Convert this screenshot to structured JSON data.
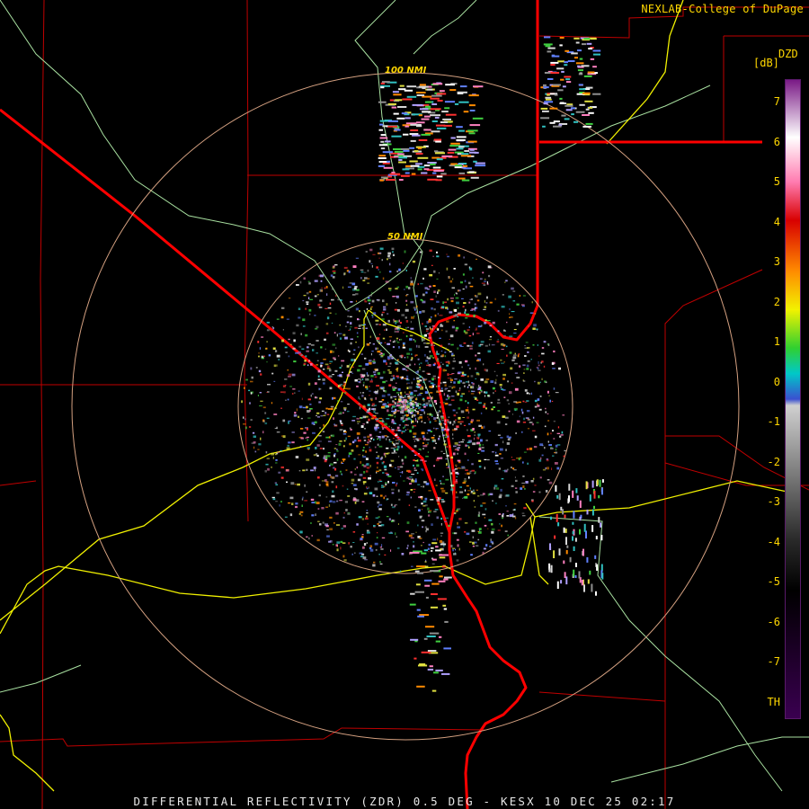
{
  "header": {
    "credit": "NEXLAB-College of DuPage"
  },
  "range_rings": [
    {
      "label": "100 NMI"
    },
    {
      "label": "50 NMI"
    }
  ],
  "legend": {
    "product": "DZD",
    "unit": "[dB]",
    "ticks": [
      "7",
      "6",
      "5",
      "4",
      "3",
      "2",
      "1",
      "0",
      "-1",
      "-2",
      "-3",
      "-4",
      "-5",
      "-6",
      "-7",
      "TH"
    ],
    "colors": {
      "top": "#7a1a86",
      "white": "#ffffff",
      "pink": "#ff7bb0",
      "red": "#d80000",
      "orange": "#ff8c00",
      "yellow": "#f2f200",
      "green": "#30d030",
      "cyan": "#00c8c8",
      "blue": "#3a50d0",
      "gray_light": "#d0d0d0",
      "gray_dark": "#2a2a2a",
      "purple_bottom": "#3a0050"
    }
  },
  "map_colors": {
    "state_border": "#ff0000",
    "county_border": "#c00000",
    "highway": "#f0f000",
    "road": "#a8e0a0",
    "range_ring": "#d4a080"
  },
  "footer": {
    "caption": "DIFFERENTIAL REFLECTIVITY (ZDR) 0.5 DEG - KESX 10 DEC 25 02:17"
  }
}
